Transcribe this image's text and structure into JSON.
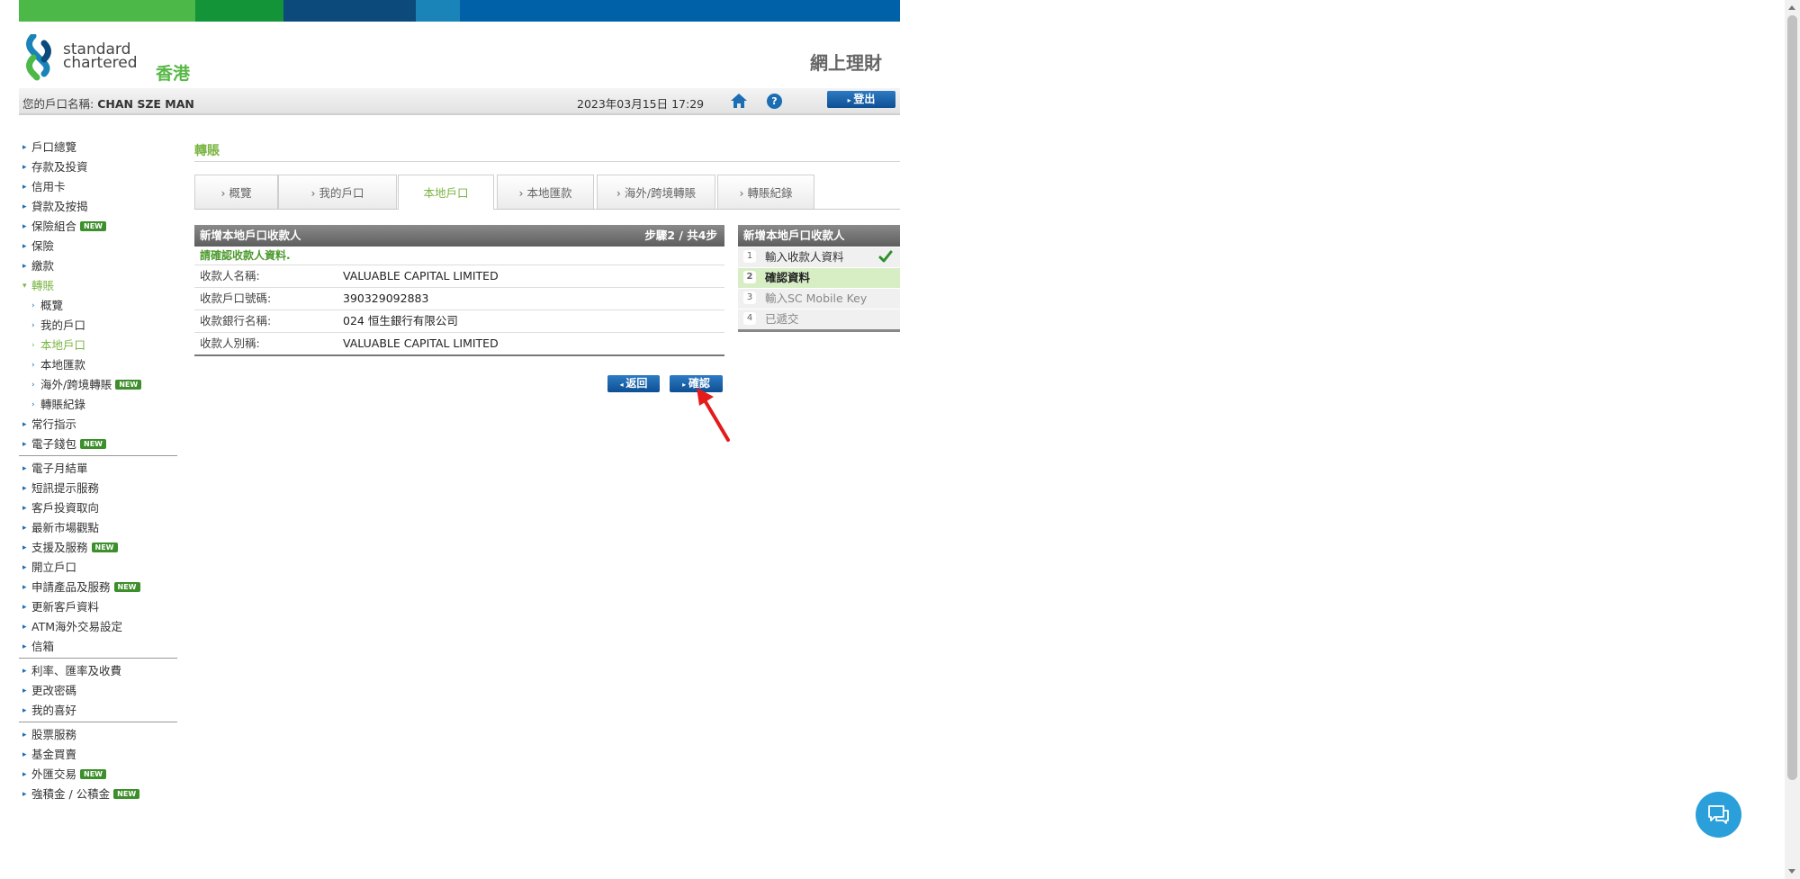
{
  "header": {
    "brand_line1": "standard",
    "brand_line2": "chartered",
    "region": "香港",
    "page_heading": "網上理財",
    "account_label": "您的戶口名稱:",
    "account_name": "CHAN SZE MAN",
    "datetime": "2023年03月15日 17:29",
    "logout_label": "登出",
    "help_glyph": "?"
  },
  "colors": {
    "green_light": "#4cb848",
    "green_dark": "#139438",
    "navy": "#0b4a7b",
    "teal": "#1a84b8",
    "blue": "#0060a8",
    "accent_green": "#7ab543"
  },
  "sidebar": {
    "new_badge": "NEW",
    "items": [
      {
        "label": "戶口總覽"
      },
      {
        "label": "存款及投資"
      },
      {
        "label": "信用卡"
      },
      {
        "label": "貸款及按揭"
      },
      {
        "label": "保險組合"
      },
      {
        "label": "保險"
      },
      {
        "label": "繳款"
      },
      {
        "label": "轉賬"
      },
      {
        "label": "概覽"
      },
      {
        "label": "我的戶口"
      },
      {
        "label": "本地戶口"
      },
      {
        "label": "本地匯款"
      },
      {
        "label": "海外/跨境轉賬"
      },
      {
        "label": "轉賬紀錄"
      },
      {
        "label": "常行指示"
      },
      {
        "label": "電子錢包"
      },
      {
        "label": "電子月結單"
      },
      {
        "label": "短訊提示服務"
      },
      {
        "label": "客戶投資取向"
      },
      {
        "label": "最新市場觀點"
      },
      {
        "label": "支援及服務"
      },
      {
        "label": "開立戶口"
      },
      {
        "label": "申請產品及服務"
      },
      {
        "label": "更新客戶資料"
      },
      {
        "label": "ATM海外交易設定"
      },
      {
        "label": "信箱"
      },
      {
        "label": "利率、匯率及收費"
      },
      {
        "label": "更改密碼"
      },
      {
        "label": "我的喜好"
      },
      {
        "label": "股票服務"
      },
      {
        "label": "基金買賣"
      },
      {
        "label": "外匯交易"
      },
      {
        "label": "強積金 / 公積金"
      }
    ]
  },
  "main": {
    "section_title": "轉賬",
    "tabs": [
      {
        "label": "› 概覽"
      },
      {
        "label": "› 我的戶口"
      },
      {
        "label": "本地戶口"
      },
      {
        "label": "› 本地匯款"
      },
      {
        "label": "› 海外/跨境轉賬"
      },
      {
        "label": "› 轉賬紀錄"
      }
    ],
    "panel": {
      "title": "新增本地戶口收款人",
      "step_text": "步驟2 / 共4步",
      "instruction": "請確認收款人資料.",
      "rows": [
        {
          "label": "收款人名稱:",
          "value": "VALUABLE CAPITAL LIMITED"
        },
        {
          "label": "收款戶口號碼:",
          "value": "390329092883"
        },
        {
          "label": "收款銀行名稱:",
          "value": "024 恒生銀行有限公司"
        },
        {
          "label": "收款人別稱:",
          "value": "VALUABLE CAPITAL LIMITED"
        }
      ]
    },
    "buttons": {
      "back": "返回",
      "confirm": "確認"
    },
    "steps_panel": {
      "title": "新增本地戶口收款人",
      "steps": [
        {
          "num": "1",
          "label": "輸入收款人資料",
          "status": "done"
        },
        {
          "num": "2",
          "label": "確認資料",
          "status": "current"
        },
        {
          "num": "3",
          "label": "輸入SC Mobile Key",
          "status": "pending"
        },
        {
          "num": "4",
          "label": "已遞交",
          "status": "pending"
        }
      ]
    }
  }
}
